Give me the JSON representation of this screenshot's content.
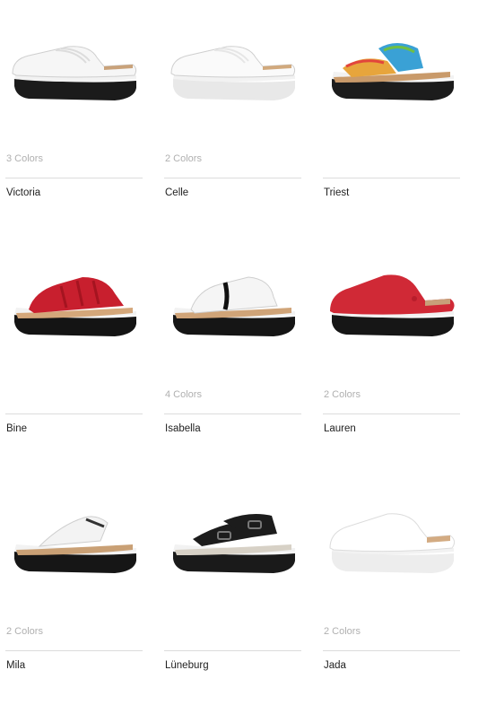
{
  "products": [
    {
      "name": "Victoria",
      "colors": "3 Colors",
      "shoe": {
        "type": "clog-closed",
        "upper": "#f6f6f6",
        "sole": "#1b1b1b",
        "bed": "#c9a27a",
        "accent": "#dcdcdc"
      }
    },
    {
      "name": "Celle",
      "colors": "2 Colors",
      "shoe": {
        "type": "clog-closed",
        "upper": "#fafafa",
        "sole": "#e8e8e8",
        "bed": "#d1a97d",
        "accent": "#e6e6e6"
      }
    },
    {
      "name": "Triest",
      "colors": "",
      "shoe": {
        "type": "braided",
        "upper": "#e7a53c",
        "sole": "#1c1c1c",
        "bed": "#c99a6a",
        "accent": "#3aa1d5"
      }
    },
    {
      "name": "Bine",
      "colors": "",
      "shoe": {
        "type": "strappy",
        "upper": "#c81f2e",
        "sole": "#141414",
        "bed": "#d4a77a",
        "accent": "#a51420"
      }
    },
    {
      "name": "Isabella",
      "colors": "4 Colors",
      "shoe": {
        "type": "open-slide",
        "upper": "#f5f5f5",
        "sole": "#151515",
        "bed": "#d0a478",
        "accent": "#111111"
      }
    },
    {
      "name": "Lauren",
      "colors": "2 Colors",
      "shoe": {
        "type": "clog-felt",
        "upper": "#d02936",
        "sole": "#161616",
        "bed": "#c8a07a",
        "accent": "#b81d2b"
      }
    },
    {
      "name": "Mila",
      "colors": "2 Colors",
      "shoe": {
        "type": "thong",
        "upper": "#f3f3f3",
        "sole": "#161616",
        "bed": "#c9a075",
        "accent": "#333333"
      }
    },
    {
      "name": "Lüneburg",
      "colors": "",
      "shoe": {
        "type": "two-strap",
        "upper": "#1c1c1c",
        "sole": "#1a1a1a",
        "bed": "#d7d1c6",
        "accent": "#777777"
      }
    },
    {
      "name": "Jada",
      "colors": "2 Colors",
      "shoe": {
        "type": "clog-plain",
        "upper": "#ffffff",
        "sole": "#ededed",
        "bed": "#d3ab82",
        "accent": "#e3e3e3"
      }
    }
  ]
}
